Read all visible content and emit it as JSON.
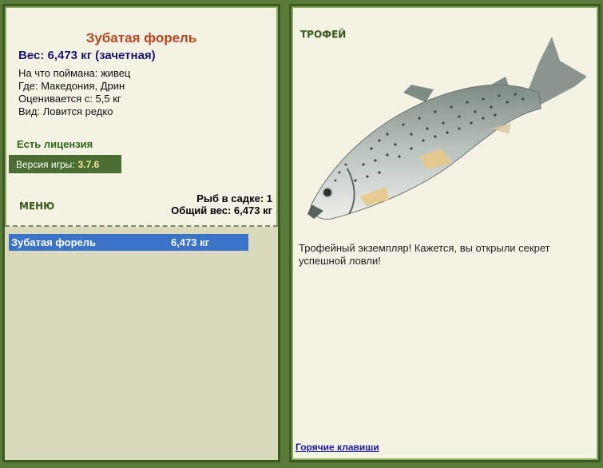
{
  "fish": {
    "name": "Зубатая форель",
    "weight_line": "Вес: 6,473 кг (зачетная)",
    "bait": "На что поймана: живец",
    "location": "Где: Македония, Дрин",
    "rated_from": "Оценивается с: 5,5 кг",
    "species_info": "Вид: Ловится редко"
  },
  "license": "Есть лицензия",
  "version": {
    "label": "Версия игры:",
    "number": "3.7.6"
  },
  "menu_label": "МЕНЮ",
  "keepnet": {
    "count_line": "Рыб в садке: 1",
    "total_line": "Общий вес: 6,473 кг"
  },
  "catch_list": [
    {
      "name": "Зубатая форель",
      "weight": "6,473 кг"
    }
  ],
  "trophy": {
    "label": "ТРОФЕЙ",
    "message": "Трофейный экземпляр! Кажется, вы открыли секрет успешной ловли!"
  },
  "hotkeys_link": "Горячие клавиши",
  "colors": {
    "frame": "#5a7a3a",
    "panel_bg": "#f4f2e2",
    "list_bg": "#d9d9bc",
    "selected_row": "#3a73c8",
    "fish_title": "#b8461e",
    "weight_text": "#18186e",
    "license_text": "#2a6a16"
  }
}
